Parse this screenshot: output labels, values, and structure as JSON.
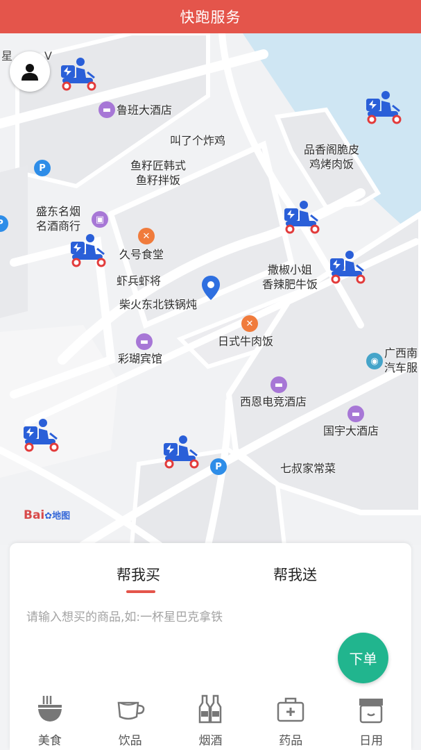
{
  "header": {
    "title": "快跑服务"
  },
  "map": {
    "poi_partial_top": "星",
    "poi_partial_top_right": "V",
    "pois": [
      {
        "id": "luban",
        "label": "鲁班大酒店",
        "icon": "hotel-icon"
      },
      {
        "id": "jiaoleji",
        "label": "叫了个炸鸡"
      },
      {
        "id": "yuzi",
        "label": "鱼籽匠韩式\n鱼籽拌饭"
      },
      {
        "id": "pinxiangge",
        "label": "品香阁脆皮\n鸡烤肉饭"
      },
      {
        "id": "shengdong",
        "label": "盛东名烟\n名酒商行",
        "icon": "shop-icon"
      },
      {
        "id": "jiuhao",
        "label": "久号食堂",
        "icon": "restaurant-icon"
      },
      {
        "id": "xiabing",
        "label": "虾兵虾将"
      },
      {
        "id": "chaihuo",
        "label": "柴火东北铁锅炖"
      },
      {
        "id": "sajiao",
        "label": "撒椒小姐\n香辣肥牛饭"
      },
      {
        "id": "rishi",
        "label": "日式牛肉饭",
        "icon": "restaurant-icon"
      },
      {
        "id": "caihu",
        "label": "彩瑚宾馆",
        "icon": "hotel-icon"
      },
      {
        "id": "guangxi",
        "label": "广西南\n汽车服",
        "icon": "car-service-icon"
      },
      {
        "id": "xien",
        "label": "西恩电竞酒店",
        "icon": "hotel-icon"
      },
      {
        "id": "guoyu",
        "label": "国宇大酒店",
        "icon": "hotel-icon"
      },
      {
        "id": "qishu",
        "label": "七叔家常菜"
      }
    ],
    "logo_text": "Bai",
    "logo_sub": "地图"
  },
  "panel": {
    "tabs": [
      {
        "label": "帮我买",
        "active": true
      },
      {
        "label": "帮我送",
        "active": false
      }
    ],
    "search_placeholder": "请输入想买的商品,如:一杯星巴克拿铁",
    "order_button": "下单",
    "categories": [
      {
        "label": "美食",
        "icon": "noodle-bowl-icon"
      },
      {
        "label": "饮品",
        "icon": "coffee-cup-icon"
      },
      {
        "label": "烟酒",
        "icon": "bottles-icon"
      },
      {
        "label": "药品",
        "icon": "medicine-box-icon"
      },
      {
        "label": "日用",
        "icon": "store-icon"
      }
    ]
  },
  "colors": {
    "brand": "#e4554b",
    "order": "#21b58e",
    "rider": "#2a5fd8"
  }
}
